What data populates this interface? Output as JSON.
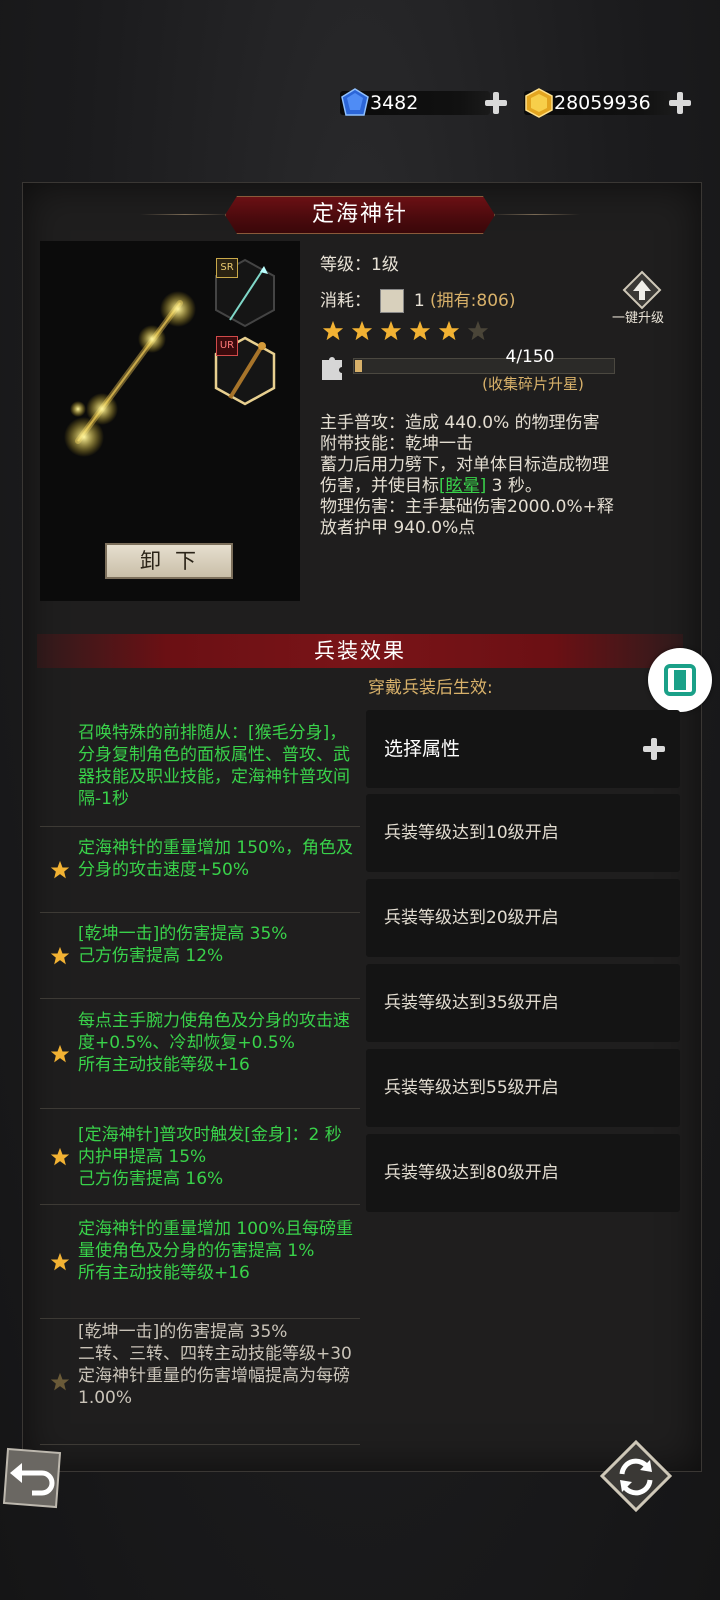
{
  "currency": {
    "diamonds": "3482",
    "gold": "28059936"
  },
  "weapon": {
    "name": "定海神针",
    "level": "等级：1级",
    "cost_label": "消耗：",
    "cost_count": "1",
    "cost_owned": "(拥有:806)",
    "stars_filled": 5,
    "stars_total": 6,
    "fragments": "4/150",
    "fragments_progress": 0.027,
    "fragments_hint": "(收集碎片升星)",
    "unequip_label": "卸下",
    "upgrade_label": "一键升级",
    "sr_badge": "SR",
    "ur_badge": "UR"
  },
  "description": {
    "line1": "主手普攻：造成 440.0% 的物理伤害",
    "line2": "附带技能：乾坤一击",
    "line3": "蓄力后用力劈下，对单体目标造成物理",
    "line4_a": "伤害，并使目标",
    "line4_link": "[眩晕]",
    "line4_b": " 3 秒。",
    "line5": "物理伤害：主手基础伤害2000.0%+释",
    "line6": "放者护甲 940.0%点"
  },
  "section": {
    "title": "兵装效果",
    "hint": "穿戴兵装后生效:"
  },
  "effects": [
    {
      "text": "召唤特殊的前排随从：[猴毛分身]，分身复制角色的面板属性、普攻、武器技能及职业技能，定海神针普攻间隔-1秒",
      "star": false,
      "active": true
    },
    {
      "text": "定海神针的重量增加 150%，角色及分身的攻击速度+50%",
      "star": true,
      "active": true
    },
    {
      "text": "[乾坤一击]的伤害提高 35%\n己方伤害提高 12%",
      "star": true,
      "active": true
    },
    {
      "text": "每点主手腕力使角色及分身的攻击速度+0.5%、冷却恢复+0.5%\n所有主动技能等级+16",
      "star": true,
      "active": true
    },
    {
      "text": "[定海神针]普攻时触发[金身]：2 秒内护甲提高 15%\n己方伤害提高 16%",
      "star": true,
      "active": true
    },
    {
      "text": "定海神针的重量增加 100%且每磅重量使角色及分身的伤害提高 1%\n所有主动技能等级+16",
      "star": true,
      "active": true
    },
    {
      "text": "[乾坤一击]的伤害提高 35%\n二转、三转、四转主动技能等级+30\n定海神针重量的伤害增幅提高为每磅 1.00%",
      "star": true,
      "active": false
    }
  ],
  "slots": {
    "select": "选择属性",
    "unlock": [
      "兵装等级达到10级开启",
      "兵装等级达到20级开启",
      "兵装等级达到35级开启",
      "兵装等级达到55级开启",
      "兵装等级达到80级开启"
    ]
  },
  "colors": {
    "accent_red": "#6b1014",
    "effect_green": "#39d24a",
    "gold_text": "#d8b16a"
  }
}
